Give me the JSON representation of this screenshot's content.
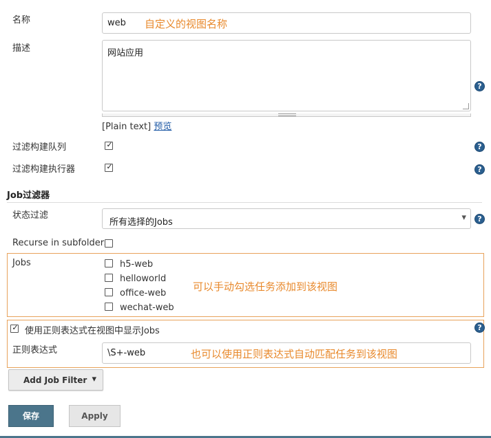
{
  "fields": {
    "name_label": "名称",
    "name_value": "web",
    "name_annotation": "自定义的视图名称",
    "desc_label": "描述",
    "desc_value": "网站应用",
    "plain_text": "[Plain text]",
    "preview_link": "预览",
    "filter_queue_label": "过滤构建队列",
    "filter_executor_label": "过滤构建执行器"
  },
  "job_filter": {
    "section_title": "Job过滤器",
    "status_label": "状态过滤",
    "status_selected": "所有选择的Jobs",
    "recurse_label": "Recurse in subfolders",
    "jobs_label": "Jobs",
    "jobs": [
      {
        "name": "h5-web",
        "checked": false
      },
      {
        "name": "helloworld",
        "checked": false
      },
      {
        "name": "office-web",
        "checked": false
      },
      {
        "name": "wechat-web",
        "checked": false
      }
    ],
    "jobs_annotation": "可以手动勾选任务添加到该视图",
    "regex_toggle_label": "使用正则表达式在视图中显示Jobs",
    "regex_label": "正则表达式",
    "regex_value": "\\S+-web",
    "regex_annotation": "也可以使用正则表达式自动匹配任务到该视图"
  },
  "buttons": {
    "add_filter": "Add Job Filter",
    "save": "保存",
    "apply": "Apply"
  },
  "icons": {
    "help": "?",
    "checkmark": "✓",
    "dropdown": "▾"
  },
  "colors": {
    "annotation": "#e8892c",
    "save_button": "#4b758b",
    "help_icon": "#2b5f8f"
  }
}
